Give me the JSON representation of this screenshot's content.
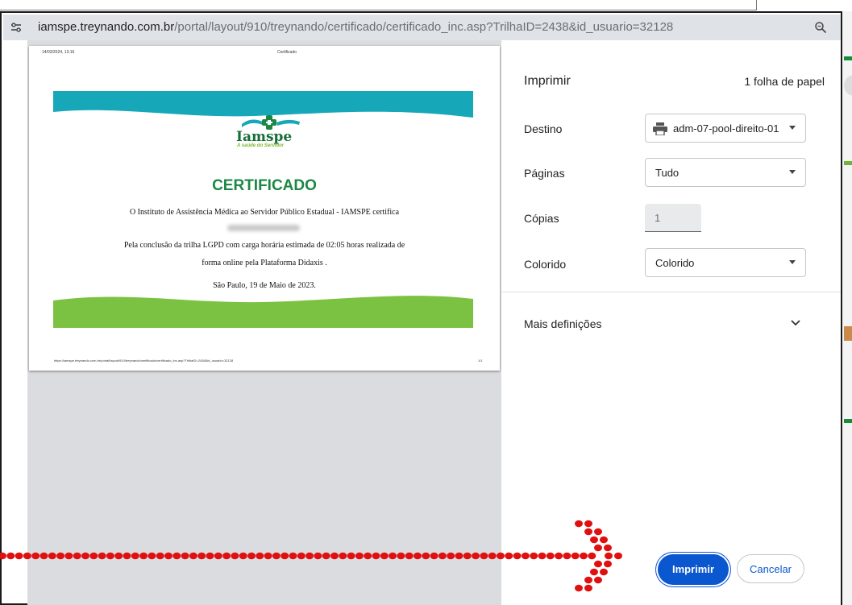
{
  "browser": {
    "url_host": "iamspe.treynando.com.br",
    "url_path": "/portal/layout/910/treynando/certificado/certificado_inc.asp?TrilhaID=2438&id_usuario=32128",
    "left_icon": "tune-icon",
    "right_icon": "zoom-icon"
  },
  "preview": {
    "header_date": "14/03/2024, 13:16",
    "header_title": "Certificado",
    "footer_url": "https://iamspe.treynando.com.br/portal/layout/910/treynando/certificado/certificado_inc.asp?TrilhaID=2438&id_usuario=32128",
    "footer_pages": "1/1",
    "logo_name": "Iamspe",
    "logo_tagline": "A saúde do Servidor",
    "certificate_title": "CERTIFICADO",
    "line1": "O Instituto de Assistência Médica ao Servidor Público Estadual - IAMSPE certifica",
    "line2": "Pela conclusão da trilha LGPD com carga horária estimada de 02:05 horas realizada de",
    "line3": "forma online pela Plataforma Didaxis .",
    "line4": "São Paulo, 19 de Maio de 2023."
  },
  "print_panel": {
    "title": "Imprimir",
    "sheets": "1 folha de papel",
    "destination_label": "Destino",
    "destination_value": "adm-07-pool-direito-01",
    "pages_label": "Páginas",
    "pages_value": "Tudo",
    "copies_label": "Cópias",
    "copies_value": "1",
    "color_label": "Colorido",
    "color_value": "Colorido",
    "more_settings": "Mais definições",
    "print_button": "Imprimir",
    "cancel_button": "Cancelar"
  },
  "colors": {
    "accent": "#0b57d0",
    "teal_wave": "#16a8b8",
    "green_wave": "#7cc242",
    "title_green": "#1c8744",
    "annotation_red": "#e01010"
  }
}
